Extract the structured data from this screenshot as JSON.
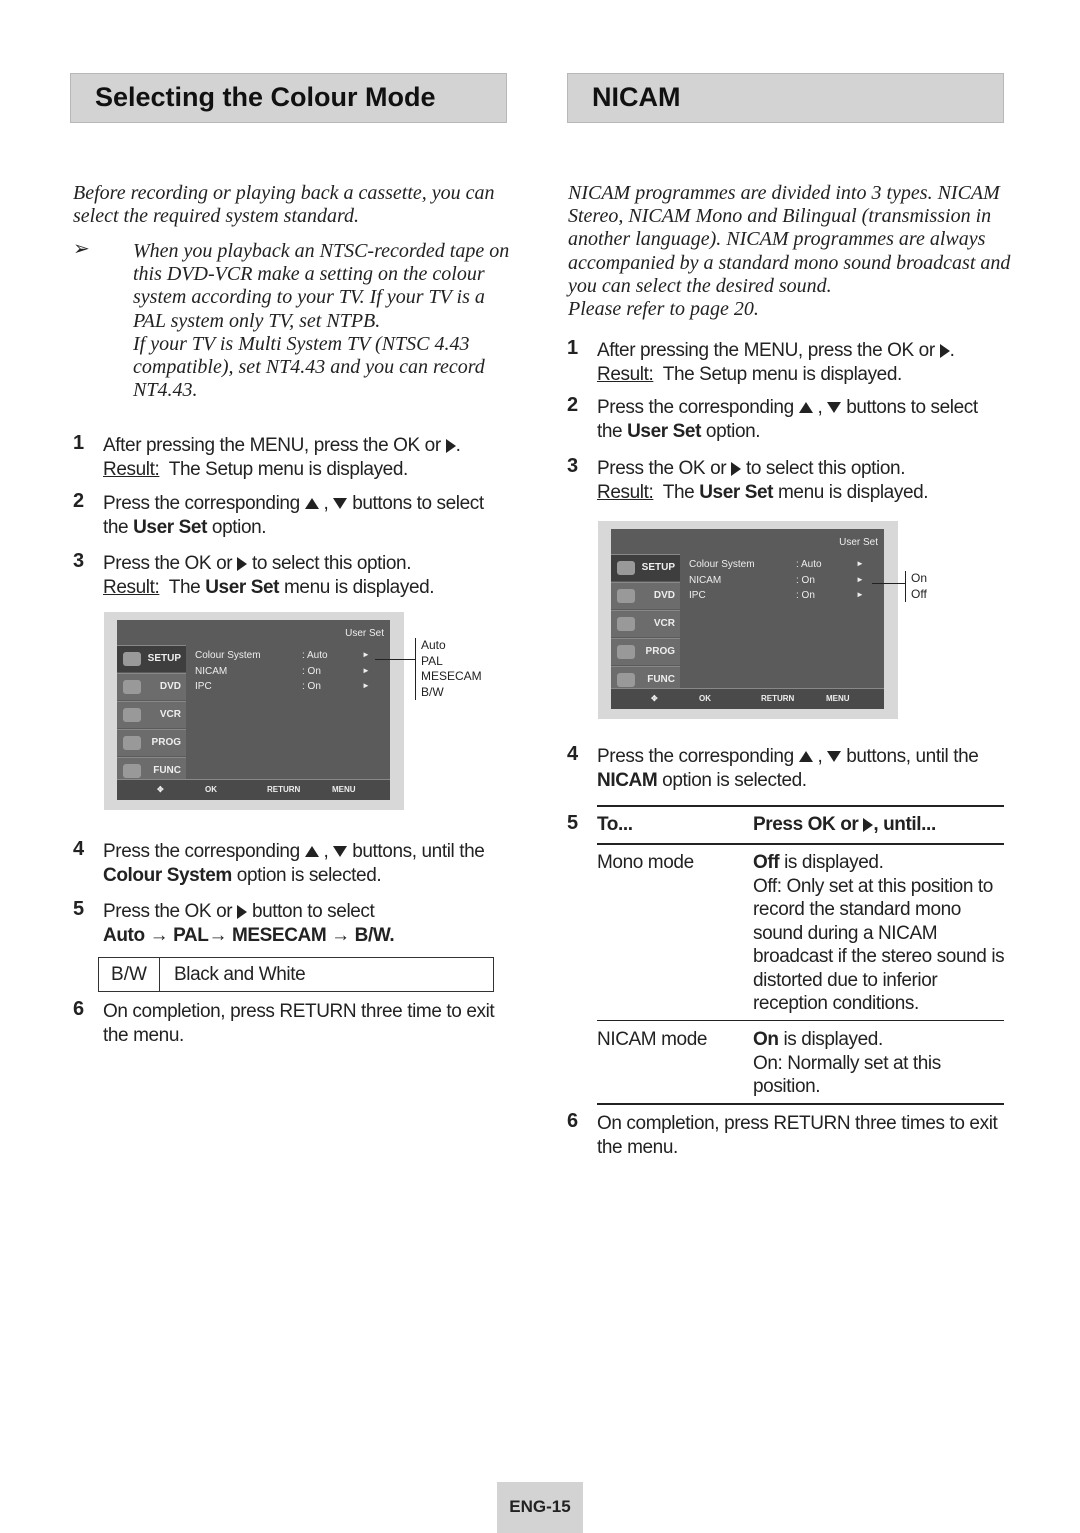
{
  "left": {
    "title": "Selecting the Colour Mode",
    "intro": [
      "Before recording or playing back a cassette, you can",
      "select the required system standard."
    ],
    "note_icon": "arrow-right-icon",
    "note_arrow": "➢",
    "note": [
      "When you playback an NTSC-recorded tape on",
      "this DVD-VCR make a setting on the colour",
      "system according to your TV. If your TV is a",
      "PAL system only TV, set NTPB.",
      "If your TV is Multi System TV (NTSC 4.43",
      "compatible), set NT4.43 and you can record",
      "NT4.43."
    ],
    "steps": [
      {
        "n": "1",
        "l1a": "After pressing the MENU, press the OK or",
        "l1b": ".",
        "result": "Result:",
        "l2": "The Setup menu is displayed."
      },
      {
        "n": "2",
        "l1a": "Press the corresponding",
        "l1b": ",",
        "l1c": "buttons to select",
        "l2a": "the",
        "l2b": "User Set",
        "l2c": "option."
      },
      {
        "n": "3",
        "l1a": "Press the OK or",
        "l1b": "to select this option.",
        "result": "Result:",
        "l2a": "The",
        "l2b": "User Set",
        "l2c": "menu is displayed."
      },
      {
        "n": "4",
        "l1a": "Press the corresponding",
        "l1b": ",",
        "l1c": "buttons, until the",
        "l2b": "Colour System",
        "l2c": "option is selected."
      },
      {
        "n": "5",
        "l1a": "Press the OK or",
        "l1b": "button to select",
        "seq": [
          "Auto",
          "PAL",
          "MESECAM",
          "B/W."
        ],
        "seq_arrow": "→"
      },
      {
        "n": "6",
        "l1": "On completion, press RETURN three time to exit",
        "l2": "the menu."
      }
    ],
    "table": {
      "key": "B/W",
      "value": "Black and White"
    },
    "options": [
      "Auto",
      "PAL",
      "MESECAM",
      "B/W"
    ]
  },
  "right": {
    "title": "NICAM",
    "intro": [
      "NICAM programmes are divided into 3 types. NICAM",
      "Stereo, NICAM Mono and Bilingual (transmission in",
      "another language). NICAM programmes are always",
      "accompanied by a standard mono sound broadcast and",
      "you can select the desired sound.",
      "Please refer to page 20."
    ],
    "steps": [
      {
        "n": "1",
        "l1a": "After pressing the MENU, press the OK or",
        "l1b": ".",
        "result": "Result:",
        "l2": "The Setup menu is displayed."
      },
      {
        "n": "2",
        "l1a": "Press the corresponding",
        "l1b": ",",
        "l1c": "buttons to select",
        "l2a": "the",
        "l2b": "User Set",
        "l2c": "option."
      },
      {
        "n": "3",
        "l1a": "Press the OK or",
        "l1b": "to select this option.",
        "result": "Result:",
        "l2a": "The",
        "l2b": "User Set",
        "l2c": "menu is displayed."
      },
      {
        "n": "4",
        "l1a": "Press the corresponding",
        "l1b": ",",
        "l1c": "buttons, until the",
        "l2b": "NICAM",
        "l2c": "option is selected."
      },
      {
        "n": "6",
        "l1": "On completion, press RETURN three times to exit",
        "l2": "the menu."
      }
    ],
    "table": {
      "n": "5",
      "h1": "To...",
      "h2a": "Press  OK or",
      "h2b": ", until...",
      "rows": [
        {
          "k": "Mono mode",
          "vb": "Off",
          "v": " is displayed.",
          "lines": [
            "Off: Only set at this position to",
            "record the standard mono",
            "sound during a NICAM",
            "broadcast if the stereo sound is",
            "distorted due to inferior",
            "reception conditions."
          ]
        },
        {
          "k": "NICAM mode",
          "vb": "On",
          "v": " is displayed.",
          "lines": [
            "On: Normally set at this",
            "position."
          ]
        }
      ]
    },
    "options": [
      "On",
      "Off"
    ]
  },
  "menu": {
    "title": "User Set",
    "side": [
      "SETUP",
      "DVD",
      "VCR",
      "PROG",
      "FUNC"
    ],
    "rows": [
      {
        "k": "Colour  System",
        "v": ": Auto"
      },
      {
        "k": "NICAM",
        "v": ": On"
      },
      {
        "k": "IPC",
        "v": ": On"
      }
    ],
    "arrow": "►",
    "bottom": {
      "ok": "OK",
      "return": "RETURN",
      "menu": "MENU"
    }
  },
  "footer": {
    "page": "ENG-15"
  }
}
